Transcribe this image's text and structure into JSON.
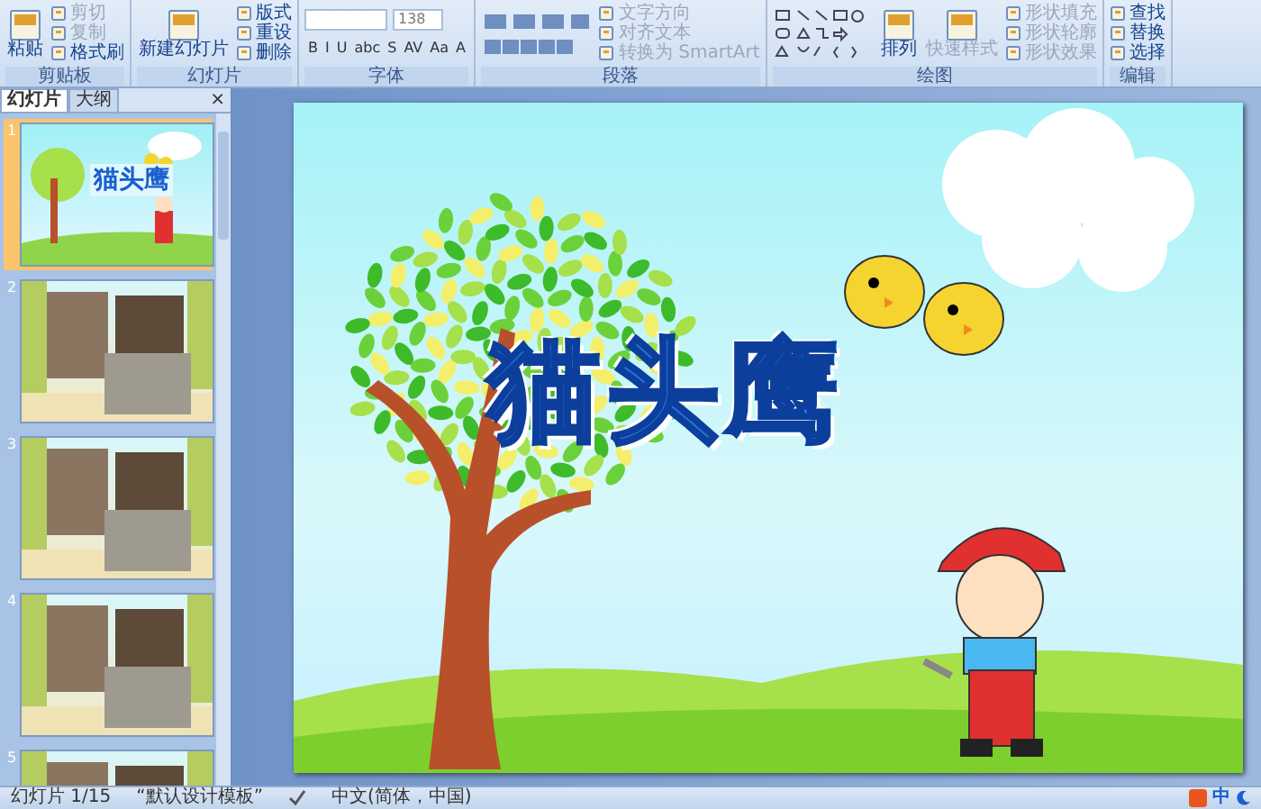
{
  "ribbon": {
    "groups": [
      {
        "label": "剪贴板",
        "items": [
          {
            "kind": "large",
            "label": "粘贴",
            "disabled": false
          },
          {
            "kind": "small",
            "label": "剪切",
            "disabled": true
          },
          {
            "kind": "small",
            "label": "复制",
            "disabled": true
          },
          {
            "kind": "small",
            "label": "格式刷",
            "disabled": false
          }
        ]
      },
      {
        "label": "幻灯片",
        "items": [
          {
            "kind": "large",
            "label": "新建幻灯片",
            "disabled": false
          },
          {
            "kind": "small",
            "label": "版式",
            "disabled": false
          },
          {
            "kind": "small",
            "label": "重设",
            "disabled": false
          },
          {
            "kind": "small",
            "label": "删除",
            "disabled": false
          }
        ]
      },
      {
        "label": "字体",
        "items": [
          {
            "kind": "font",
            "value": "138",
            "buttons": [
              "B",
              "I",
              "U",
              "abc",
              "S",
              "AV",
              "Aa",
              "A"
            ]
          }
        ]
      },
      {
        "label": "段落",
        "items": [
          {
            "kind": "lists"
          },
          {
            "kind": "small",
            "label": "文字方向",
            "disabled": true
          },
          {
            "kind": "small",
            "label": "对齐文本",
            "disabled": true
          },
          {
            "kind": "small",
            "label": "转换为 SmartArt",
            "disabled": true
          }
        ]
      },
      {
        "label": "绘图",
        "items": [
          {
            "kind": "shapes"
          },
          {
            "kind": "large",
            "label": "排列",
            "disabled": false
          },
          {
            "kind": "large",
            "label": "快速样式",
            "disabled": true
          },
          {
            "kind": "small",
            "label": "形状填充",
            "disabled": true
          },
          {
            "kind": "small",
            "label": "形状轮廓",
            "disabled": true
          },
          {
            "kind": "small",
            "label": "形状效果",
            "disabled": true
          }
        ]
      },
      {
        "label": "编辑",
        "items": [
          {
            "kind": "small",
            "label": "查找",
            "disabled": false
          },
          {
            "kind": "small",
            "label": "替换",
            "disabled": false
          },
          {
            "kind": "small",
            "label": "选择",
            "disabled": false
          }
        ]
      }
    ]
  },
  "panel": {
    "tabs": [
      {
        "label": "幻灯片",
        "selected": true
      },
      {
        "label": "大纲",
        "selected": false
      }
    ],
    "close": "×",
    "slides": [
      {
        "number": "1",
        "kind": "title",
        "title": "猫头鹰",
        "selected": true
      },
      {
        "number": "2",
        "kind": "photos",
        "selected": false
      },
      {
        "number": "3",
        "kind": "photos",
        "selected": false
      },
      {
        "number": "4",
        "kind": "photos",
        "selected": false
      },
      {
        "number": "5",
        "kind": "photos",
        "selected": false
      }
    ]
  },
  "slide": {
    "title": "猫头鹰"
  },
  "status_bar": {
    "slide": "幻灯片 1/15",
    "theme": "“默认设计模板”",
    "language": "中文(简体，中国)",
    "ime": "中"
  }
}
